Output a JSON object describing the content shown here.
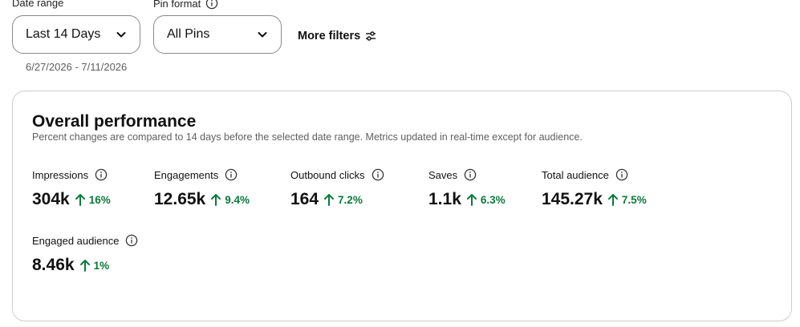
{
  "filters": {
    "date_range": {
      "label": "Date range",
      "selected": "Last 14 Days",
      "readout": "6/27/2026 - 7/11/2026"
    },
    "pin_format": {
      "label": "Pin format",
      "selected": "All Pins"
    },
    "more_filters_label": "More filters"
  },
  "performance": {
    "title": "Overall performance",
    "subtitle": "Percent changes are compared to 14 days before the selected date range. Metrics updated in real-time except for audience.",
    "metrics": [
      {
        "label": "Impressions",
        "value": "304k",
        "change": "16%"
      },
      {
        "label": "Engagements",
        "value": "12.65k",
        "change": "9.4%"
      },
      {
        "label": "Outbound clicks",
        "value": "164",
        "change": "7.2%"
      },
      {
        "label": "Saves",
        "value": "1.1k",
        "change": "6.3%"
      },
      {
        "label": "Total audience",
        "value": "145.27k",
        "change": "7.5%"
      },
      {
        "label": "Engaged audience",
        "value": "8.46k",
        "change": "1%"
      }
    ]
  },
  "colors": {
    "positive_change": "#0b7a3b",
    "border": "#cdcdcd",
    "muted_text": "#5f5f5f"
  },
  "icons": {
    "info": "info-icon",
    "dropdown": "chevron-down-icon",
    "filters": "sliders-icon",
    "change": "arrow-up-icon"
  }
}
